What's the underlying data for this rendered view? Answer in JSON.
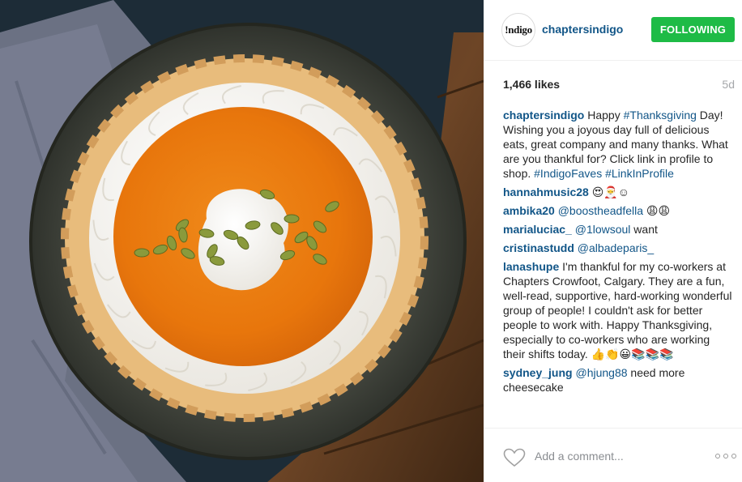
{
  "post": {
    "photo_alt": "Pumpkin pie with whipped cream and pepitas",
    "header": {
      "avatar_text": "!ndigo",
      "username": "chaptersindigo",
      "follow_label": "FOLLOWING"
    },
    "likes": "1,466 likes",
    "age": "5d",
    "comments": [
      {
        "user": "chaptersindigo",
        "parts": [
          {
            "t": "Happy ",
            "link": false
          },
          {
            "t": "#Thanksgiving",
            "link": true
          },
          {
            "t": " Day! Wishing you a joyous day full of delicious eats, great company and many thanks. What are you thankful for? Click link in profile to shop. ",
            "link": false
          },
          {
            "t": "#IndigoFaves",
            "link": true
          },
          {
            "t": " ",
            "link": false
          },
          {
            "t": "#LinkInProfile",
            "link": true
          }
        ]
      },
      {
        "user": "hannahmusic28",
        "parts": [
          {
            "t": "😍🎅☺",
            "link": false
          }
        ]
      },
      {
        "user": "ambika20",
        "parts": [
          {
            "t": "@boostheadfella",
            "link": true
          },
          {
            "t": " 😩😩",
            "link": false
          }
        ]
      },
      {
        "user": "marialuciac_",
        "parts": [
          {
            "t": "@1lowsoul",
            "link": true
          },
          {
            "t": " want",
            "link": false
          }
        ]
      },
      {
        "user": "cristinastudd",
        "parts": [
          {
            "t": "@albadeparis_",
            "link": true
          }
        ]
      },
      {
        "user": "lanashupe",
        "parts": [
          {
            "t": "I'm thankful for my co-workers at Chapters Crowfoot, Calgary. They are a fun, well-read, supportive, hard-working wonderful group of people! I couldn't ask for better people to work with. Happy Thanksgiving, especially to co-workers who are working their shifts today. 👍👏😀📚📚📚",
            "link": false
          }
        ]
      },
      {
        "user": "sydney_jung",
        "parts": [
          {
            "t": "@hjung88",
            "link": true
          },
          {
            "t": " need more cheesecake",
            "link": false
          }
        ]
      }
    ],
    "footer": {
      "comment_placeholder": "Add a comment..."
    }
  },
  "colors": {
    "username": "#125688",
    "follow_button": "#1ebb46",
    "muted": "#a5a7aa"
  }
}
